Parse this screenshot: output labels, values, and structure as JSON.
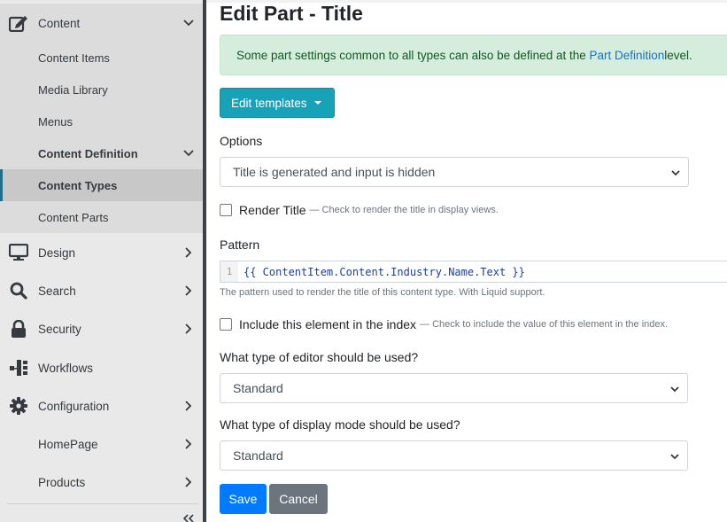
{
  "sidebar": {
    "content": {
      "label": "Content",
      "icon": "edit-icon",
      "expanded": true
    },
    "content_items": [
      "Content Items",
      "Media Library",
      "Menus"
    ],
    "content_definition": {
      "label": "Content Definition",
      "expanded": true
    },
    "content_types": {
      "label": "Content Types",
      "active": true
    },
    "content_parts": {
      "label": "Content Parts"
    },
    "groups": [
      {
        "label": "Design",
        "icon": "monitor-icon"
      },
      {
        "label": "Search",
        "icon": "search-icon"
      },
      {
        "label": "Security",
        "icon": "lock-icon"
      },
      {
        "label": "Workflows",
        "icon": "workflow-icon"
      },
      {
        "label": "Configuration",
        "icon": "gear-icon"
      },
      {
        "label": "HomePage",
        "icon": ""
      },
      {
        "label": "Products",
        "icon": ""
      }
    ]
  },
  "main": {
    "title": "Edit Part - Title",
    "alert": {
      "text_before": "Some part settings common to all types can also be defined at the ",
      "link": "Part Definition",
      "text_after": " level."
    },
    "edit_templates_label": "Edit templates",
    "options": {
      "label": "Options",
      "value": "Title is generated and input is hidden"
    },
    "render_title": {
      "label": "Render Title",
      "hint": "— Check to render the title in display views.",
      "checked": false
    },
    "pattern": {
      "label": "Pattern",
      "line_number": "1",
      "code": "{{ ContentItem.Content.Industry.Name.Text }}",
      "help": "The pattern used to render the title of this content type. With Liquid support."
    },
    "index": {
      "label": "Include this element in the index",
      "hint": "— Check to include the value of this element in the index.",
      "checked": false
    },
    "editor": {
      "label": "What type of editor should be used?",
      "value": "Standard"
    },
    "display_mode": {
      "label": "What type of display mode should be used?",
      "value": "Standard"
    },
    "save_label": "Save",
    "cancel_label": "Cancel"
  },
  "colors": {
    "primary": "#007bff",
    "info": "#17a2b8",
    "secondary": "#6c757d",
    "alert_bg": "#d4eddc",
    "sidebar_bg": "#e9e9e9"
  }
}
